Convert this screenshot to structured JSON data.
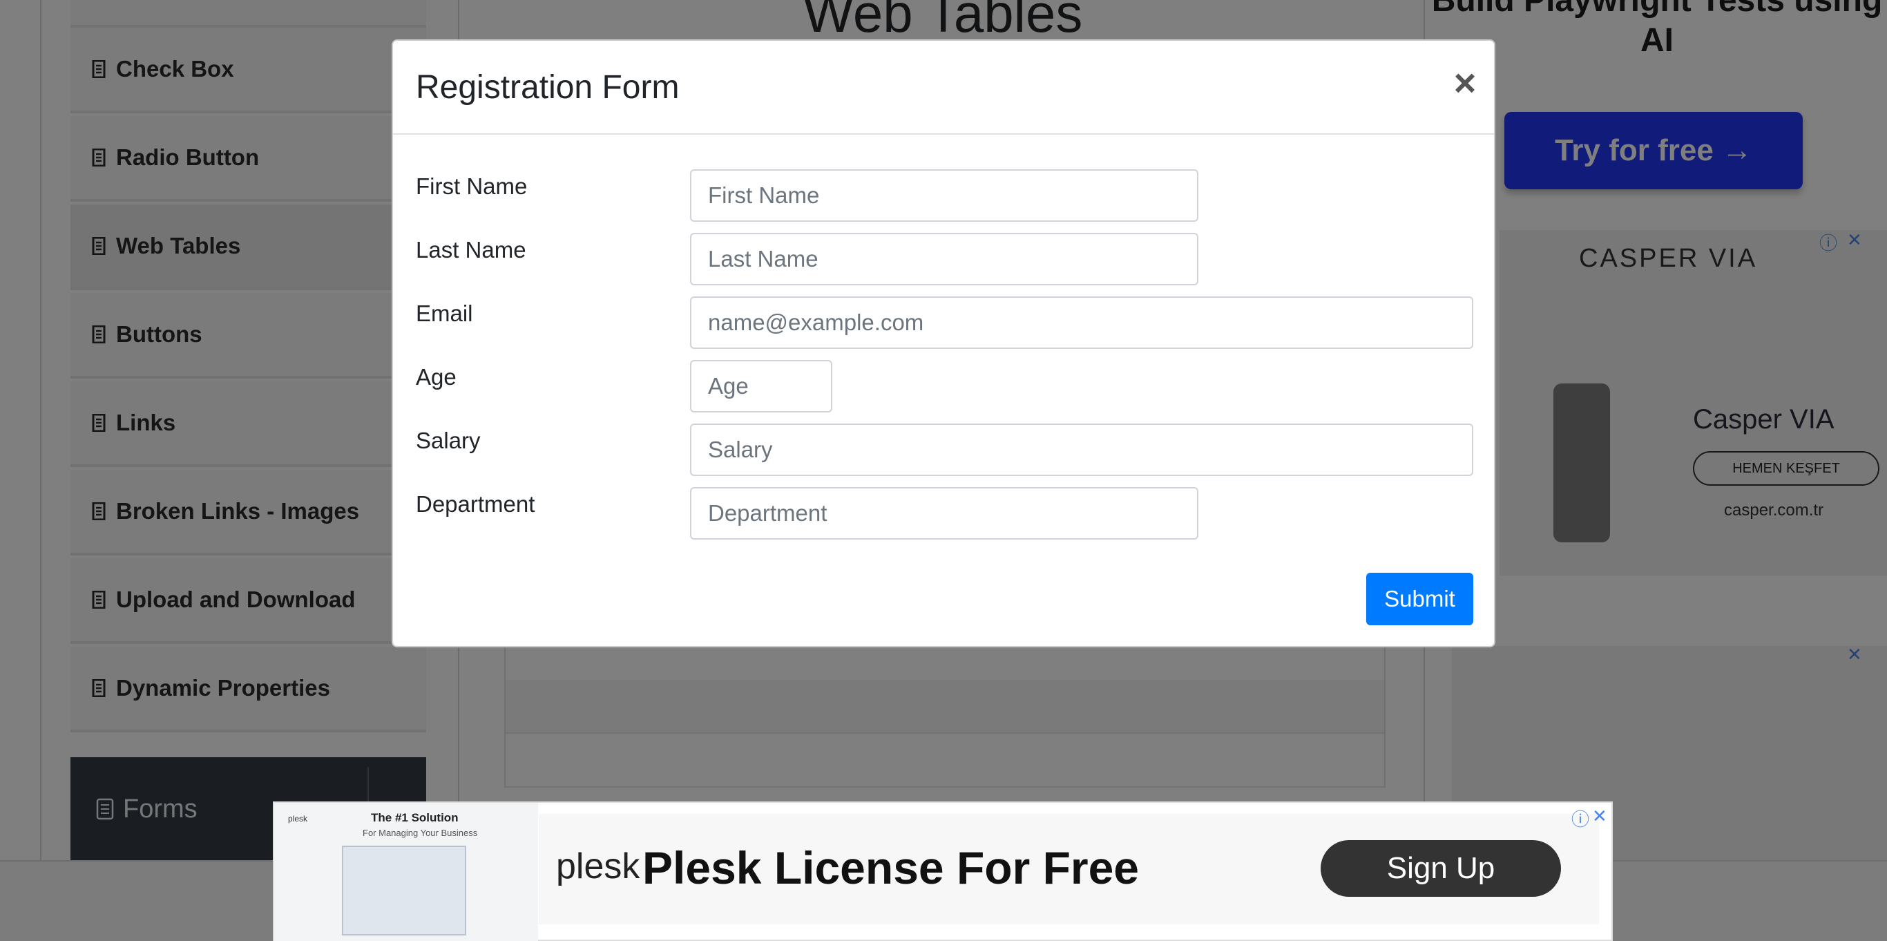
{
  "sidebar": {
    "items": [
      {
        "label": "Check Box"
      },
      {
        "label": "Radio Button"
      },
      {
        "label": "Web Tables"
      },
      {
        "label": "Buttons"
      },
      {
        "label": "Links"
      },
      {
        "label": "Broken Links - Images"
      },
      {
        "label": "Upload and Download"
      },
      {
        "label": "Dynamic Properties"
      }
    ],
    "group_label": "Forms"
  },
  "main": {
    "title": "Web Tables"
  },
  "right_ads": {
    "promo_title": "Build Playwright Tests using AI",
    "promo_button": "Try for free →",
    "casper_brand": "CASPER  VIA",
    "casper_brand2": "Casper VIA",
    "casper_cta": "HEMEN KEŞFET",
    "casper_site": "casper.com.tr",
    "info_icon": "ⓘ",
    "close_icon": "✕"
  },
  "modal": {
    "title": "Registration Form",
    "close_label": "×",
    "fields": {
      "first_name": {
        "label": "First Name",
        "placeholder": "First Name",
        "value": ""
      },
      "last_name": {
        "label": "Last Name",
        "placeholder": "Last Name",
        "value": ""
      },
      "email": {
        "label": "Email",
        "placeholder": "name@example.com",
        "value": ""
      },
      "age": {
        "label": "Age",
        "placeholder": "Age",
        "value": ""
      },
      "salary": {
        "label": "Salary",
        "placeholder": "Salary",
        "value": ""
      },
      "department": {
        "label": "Department",
        "placeholder": "Department",
        "value": ""
      }
    },
    "submit_label": "Submit"
  },
  "banner": {
    "thumb_brand": "plesk",
    "thumb_title": "The #1 Solution",
    "thumb_subtitle": "For Managing Your Business",
    "logo": "plesk",
    "title": "Plesk License For Free",
    "cta": "Sign Up",
    "info_icon": "ⓘ",
    "close_icon": "✕"
  }
}
